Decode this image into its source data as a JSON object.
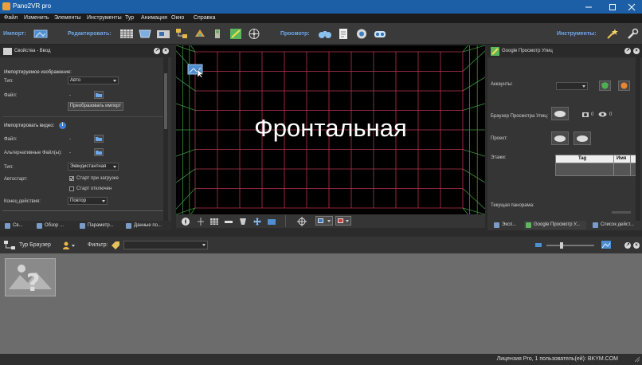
{
  "window": {
    "title": "Pano2VR pro",
    "min_icon": "minimize-icon",
    "max_icon": "maximize-icon",
    "close_icon": "close-icon"
  },
  "menu": [
    "Файл",
    "Изменить",
    "Элементы",
    "Инструменты",
    "Тур",
    "Анимация",
    "Окно",
    "Справка"
  ],
  "toolbar": {
    "import_label": "Импорт:",
    "edit_label": "Редактировать:",
    "view_label": "Просмотр:",
    "tools_label": "Инструменты:"
  },
  "left_panel": {
    "title": "Свойства - Ввод",
    "import_image": {
      "title": "Импортируемое изображение:",
      "type_label": "Тип:",
      "type_value": "Авто",
      "file_label": "Файл:",
      "file_value": "-",
      "convert_button": "Преобразовать импорт"
    },
    "import_video": {
      "title": "Импортировать видео:",
      "file_label": "Файл:",
      "file_value": "-",
      "alt_files_label": "Альтернативные Файл(ы):",
      "alt_files_value": "-",
      "type_label": "Тип:",
      "type_value": "Эквидистантная",
      "autostart_label": "Автостарт:",
      "autostart_option": "Старт при загрузке",
      "start_disabled": "Старт отключен",
      "end_action_label": "Конец действия:",
      "end_action_value": "Повтор"
    },
    "tabs": [
      "Св...",
      "Обзор ...",
      "Параметр...",
      "Данные по..."
    ]
  },
  "viewport": {
    "face_label": "Фронтальная",
    "grid_colors": {
      "back": "#b8344f",
      "side": "#3f8f3f"
    }
  },
  "right_panel": {
    "title": "Google Просмотр Улиц",
    "accounts_label": "Аккаунты:",
    "street_browser_label": "Браузер Просмотра Улиц:",
    "photos_count": "0",
    "views_count": "0",
    "project_label": "Проект:",
    "floors_label": "Этажи:",
    "table_headers": [
      "Tag",
      "Имя"
    ],
    "current_panorama_label": "Текущая панорама:",
    "tabs": [
      "Эксп...",
      "Google Просмотр У...",
      "Список дейст..."
    ]
  },
  "tour_browser": {
    "title": "Тур Браузер",
    "filter_label": "Фильтр:",
    "filter_value": "",
    "zoom_fraction": 0.3
  },
  "status": {
    "license": "Лицензия Pro, 1 пользователь(ей): BKYM.COM"
  }
}
